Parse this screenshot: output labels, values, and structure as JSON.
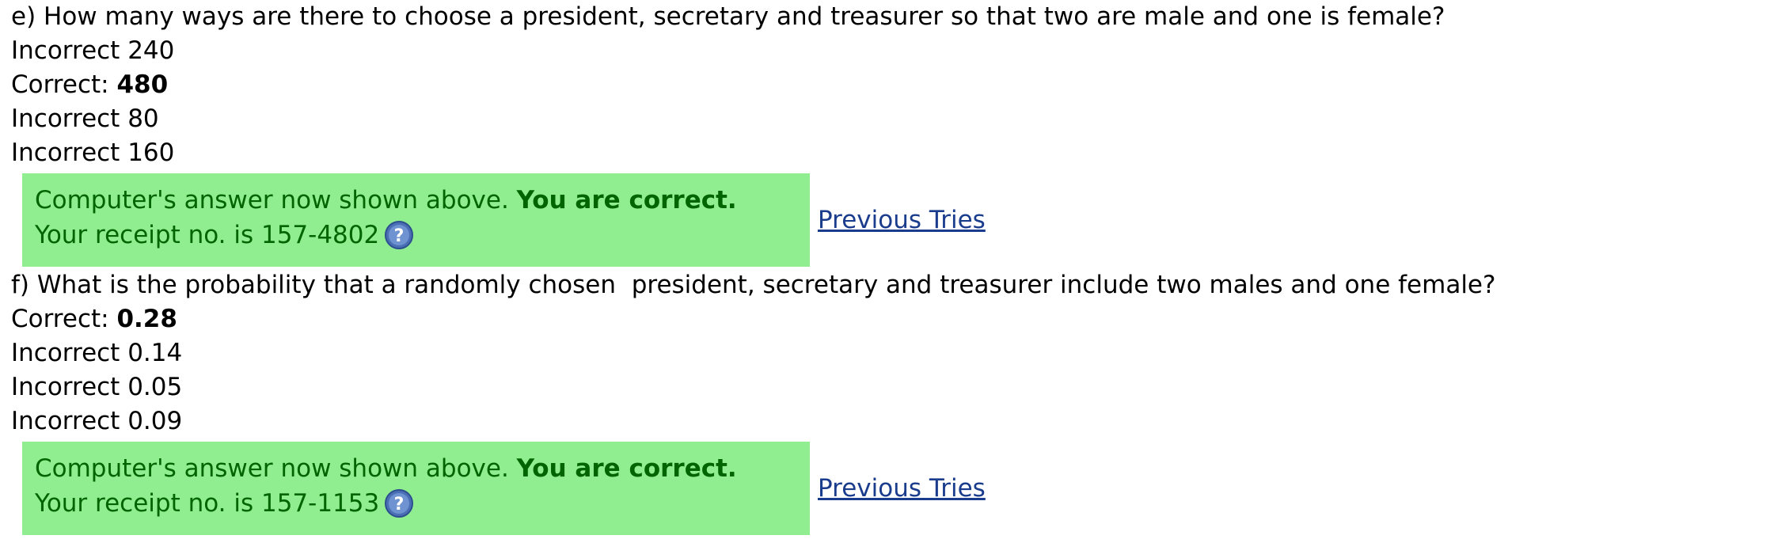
{
  "parts": [
    {
      "question": "e) How many ways are there to choose a president, secretary and treasurer so that two are male and one is female?",
      "options": [
        {
          "status": "Incorrect",
          "sep": " ",
          "value": "240",
          "correct": false
        },
        {
          "status": "Correct:",
          "sep": " ",
          "value": "480",
          "correct": true
        },
        {
          "status": "Incorrect",
          "sep": " ",
          "value": "80",
          "correct": false
        },
        {
          "status": "Incorrect",
          "sep": " ",
          "value": "160",
          "correct": false
        }
      ],
      "feedback": {
        "line1_prefix": "Computer's answer now shown above. ",
        "line1_bold": "You are correct.",
        "line2": "Your receipt no. is 157-4802"
      },
      "previous_tries": "Previous Tries"
    },
    {
      "question": "f) What is the probability that a randomly chosen  president, secretary and treasurer include two males and one female?",
      "options": [
        {
          "status": "Correct:",
          "sep": " ",
          "value": "0.28",
          "correct": true
        },
        {
          "status": "Incorrect",
          "sep": " ",
          "value": "0.14",
          "correct": false
        },
        {
          "status": "Incorrect",
          "sep": " ",
          "value": "0.05",
          "correct": false
        },
        {
          "status": "Incorrect",
          "sep": " ",
          "value": "0.09",
          "correct": false
        }
      ],
      "feedback": {
        "line1_prefix": "Computer's answer now shown above. ",
        "line1_bold": "You are correct.",
        "line2": "Your receipt no. is 157-1153"
      },
      "previous_tries": "Previous Tries"
    }
  ],
  "icons": {
    "help": "help-question-icon"
  },
  "colors": {
    "feedback_bg": "#90ee90",
    "feedback_text": "#006400",
    "link": "#1a3c8c",
    "help_icon": "#4a6fb5"
  }
}
